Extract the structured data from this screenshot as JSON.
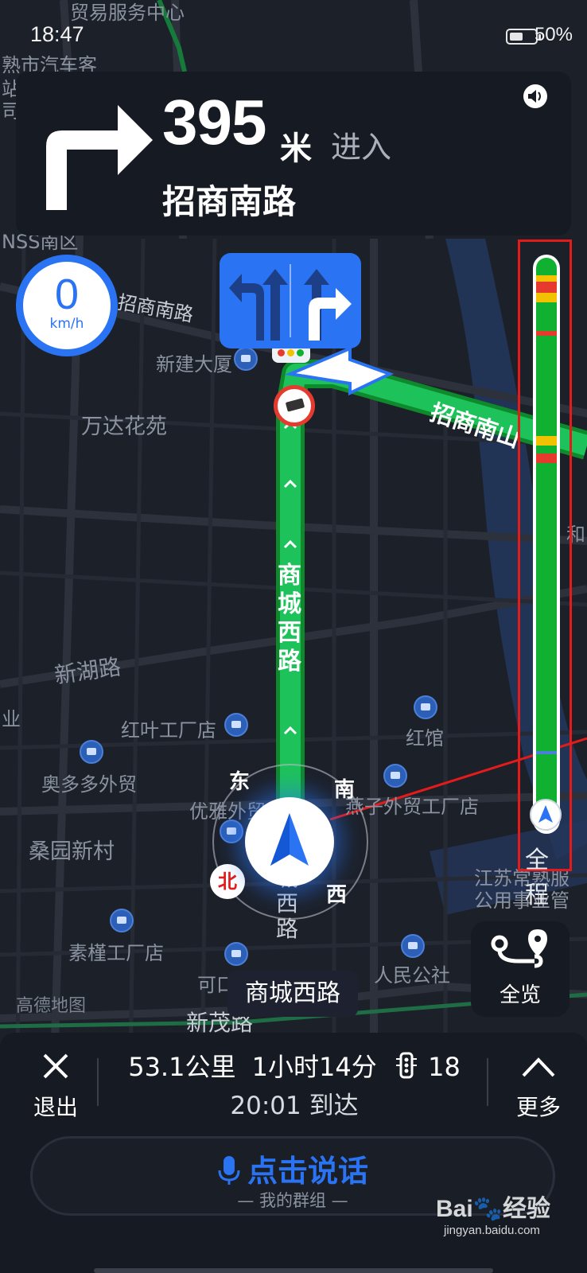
{
  "status_bar": {
    "time": "18:47",
    "battery": "50%"
  },
  "navigation": {
    "distance_value": "395",
    "distance_unit": "米",
    "action": "进入",
    "next_road": "招商南路"
  },
  "speed": {
    "value": "0",
    "unit": "km/h"
  },
  "route_progress": {
    "label": "全程",
    "traversed_fraction": 0.0
  },
  "map": {
    "labels": {
      "top_poi": "贸易服务中心",
      "top_left_1": "熟市汽车客",
      "top_left_2": "站",
      "top_left_3": "司",
      "area_nss": "NSS南区",
      "road_zhaoshang_left": "招商南路",
      "poi_xinjian": "新建大厦",
      "poi_wanda": "万达花苑",
      "road_zhaoshang_right": "招商南山",
      "road_shangcheng_vertical": "商城西路",
      "road_xinhu": "新湖路",
      "poi_hongye": "红叶工厂店",
      "poi_aoduoduo": "奥多多外贸",
      "poi_honguan": "红馆",
      "poi_yanzi": "燕子外贸工厂店",
      "poi_youya": "优雅外贸",
      "area_sangyuan": "桑园新村",
      "road_shangcheng_lower": "城西路",
      "poi_sujin": "素槿工厂店",
      "poi_kekou": "可口",
      "poi_renmin": "人民公社",
      "poi_jiangsu_1": "江苏常熟服",
      "poi_jiangsu_2": "公用事业管",
      "road_xinmao": "新茂路",
      "left_edge_ye": "业",
      "brand": "高德地图",
      "right_edge_he": "和"
    },
    "compass": {
      "east": "东",
      "south": "南",
      "west": "西",
      "north": "北"
    },
    "current_road": "商城西路"
  },
  "overview_button": {
    "label": "全览"
  },
  "bottom_panel": {
    "exit_label": "退出",
    "distance": "53.1公里",
    "duration": "1小时14分",
    "traffic_lights": "18",
    "arrival_time": "20:01",
    "arrival_suffix": "到达",
    "more_label": "更多"
  },
  "voice": {
    "label": "点击说话",
    "sublabel": "— 我的群组 —"
  },
  "watermark": {
    "brand": "Bai",
    "brand_cn": "经验",
    "url": "jingyan.baidu.com"
  },
  "colors": {
    "accent_blue": "#2a74f4",
    "route_green": "#10b130",
    "congestion_red": "#e63a2f",
    "slow_yellow": "#f2c200",
    "highlight_red": "#e31b1b"
  }
}
